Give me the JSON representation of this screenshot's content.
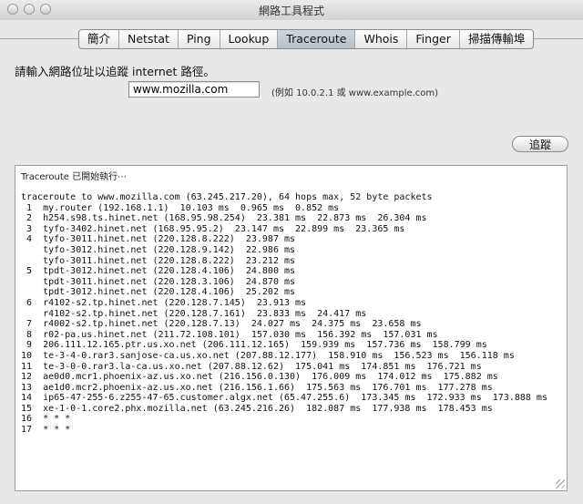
{
  "window": {
    "title": "網路工具程式"
  },
  "tabs": [
    {
      "label": "簡介",
      "active": false
    },
    {
      "label": "Netstat",
      "active": false
    },
    {
      "label": "Ping",
      "active": false
    },
    {
      "label": "Lookup",
      "active": false
    },
    {
      "label": "Traceroute",
      "active": true
    },
    {
      "label": "Whois",
      "active": false
    },
    {
      "label": "Finger",
      "active": false
    },
    {
      "label": "掃描傳輸埠",
      "active": false
    }
  ],
  "form": {
    "prompt": "請輸入網路位址以追蹤 internet 路徑。",
    "host_value": "www.mozilla.com",
    "example": "(例如 10.0.2.1 或 www.example.com)",
    "trace_button": "追蹤"
  },
  "output": {
    "status": "Traceroute 已開始執行⋯",
    "lines": [
      "traceroute to www.mozilla.com (63.245.217.20), 64 hops max, 52 byte packets",
      " 1  my.router (192.168.1.1)  10.103 ms  0.965 ms  0.852 ms",
      " 2  h254.s98.ts.hinet.net (168.95.98.254)  23.381 ms  22.873 ms  26.304 ms",
      " 3  tyfo-3402.hinet.net (168.95.95.2)  23.147 ms  22.899 ms  23.365 ms",
      " 4  tyfo-3011.hinet.net (220.128.8.222)  23.987 ms",
      "    tyfo-3012.hinet.net (220.128.9.142)  22.986 ms",
      "    tyfo-3011.hinet.net (220.128.8.222)  23.212 ms",
      " 5  tpdt-3012.hinet.net (220.128.4.106)  24.800 ms",
      "    tpdt-3011.hinet.net (220.128.3.106)  24.870 ms",
      "    tpdt-3012.hinet.net (220.128.4.106)  25.202 ms",
      " 6  r4102-s2.tp.hinet.net (220.128.7.145)  23.913 ms",
      "    r4102-s2.tp.hinet.net (220.128.7.161)  23.833 ms  24.417 ms",
      " 7  r4002-s2.tp.hinet.net (220.128.7.13)  24.027 ms  24.375 ms  23.658 ms",
      " 8  r02-pa.us.hinet.net (211.72.108.101)  157.030 ms  156.392 ms  157.031 ms",
      " 9  206.111.12.165.ptr.us.xo.net (206.111.12.165)  159.939 ms  157.736 ms  158.799 ms",
      "10  te-3-4-0.rar3.sanjose-ca.us.xo.net (207.88.12.177)  158.910 ms  156.523 ms  156.118 ms",
      "11  te-3-0-0.rar3.la-ca.us.xo.net (207.88.12.62)  175.041 ms  174.851 ms  176.721 ms",
      "12  ae0d0.mcr1.phoenix-az.us.xo.net (216.156.0.130)  176.009 ms  174.012 ms  175.882 ms",
      "13  ae1d0.mcr2.phoenix-az.us.xo.net (216.156.1.66)  175.563 ms  176.701 ms  177.278 ms",
      "14  ip65-47-255-6.z255-47-65.customer.algx.net (65.47.255.6)  173.345 ms  172.933 ms  173.888 ms",
      "15  xe-1-0-1.core2.phx.mozilla.net (63.245.216.26)  182.087 ms  177.938 ms  178.453 ms",
      "16  * * *",
      "17  * * *"
    ]
  }
}
